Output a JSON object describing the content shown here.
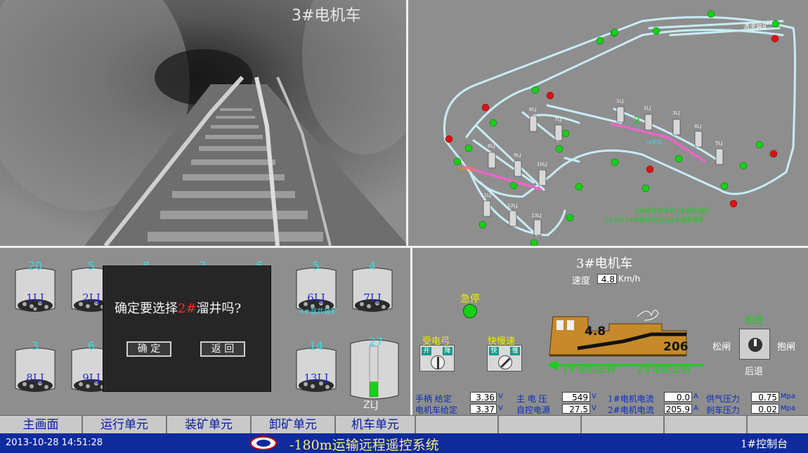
{
  "camera": {
    "title": "3#电机车"
  },
  "map": {
    "top_label": "清求装矿",
    "loco_labels": [
      "3#机车",
      "2#机车"
    ],
    "loco2_num": "2",
    "bins": [
      "1LJ",
      "2LJ",
      "3LJ",
      "4LJ",
      "5LJ",
      "6LJ",
      "7LJ",
      "8LJ",
      "9LJ",
      "10LJ",
      "11LJ",
      "12LJ",
      "13LJ"
    ],
    "log": [
      "2#操作台正在2#溜井装矿",
      "12:23:14本操作台正在8#溜井装矿"
    ]
  },
  "bins": {
    "row1": [
      {
        "name": "1LJ",
        "count": "20"
      },
      {
        "name": "2LJ",
        "count": "5"
      },
      {
        "name": "",
        "count": "8"
      },
      {
        "name": "",
        "count": "7"
      },
      {
        "name": "",
        "count": "6"
      },
      {
        "name": "6LJ",
        "count": "5"
      },
      {
        "name": "7LJ",
        "count": "4"
      }
    ],
    "row2": [
      {
        "name": "8LJ",
        "count": "3"
      },
      {
        "name": "9LJ",
        "count": "6"
      },
      {
        "name": "13LJ",
        "count": "14"
      }
    ],
    "main_bin": {
      "name": "ZLJ",
      "count": "27",
      "level": 0.3
    },
    "overlay_text": "4#溜井装矿"
  },
  "dialog": {
    "prefix": "确定要选择",
    "highlight": "2#",
    "suffix": "溜井吗?",
    "ok": "确 定",
    "back": "返 回"
  },
  "loco": {
    "title": "3#电机车",
    "speed_label": "速度",
    "speed_value": "4.8",
    "speed_unit": "Km/h",
    "estop_label": "急停",
    "power_label": "受电弓",
    "power_on": "开",
    "power_off": "降",
    "speed_switch_label": "快慢速",
    "fast": "快",
    "slow": "慢",
    "loco_value": "4.8",
    "loco_number": "206",
    "motor1": "1#电机正转",
    "motor2": "2#电机正转",
    "forward": "前进",
    "backward": "后退",
    "release": "松闸",
    "brake": "抱闸",
    "readouts": {
      "handle_label": "手柄  给定",
      "handle_value": "3.36",
      "loco_given_label": "电机车给定",
      "loco_given_value": "3.37",
      "main_v_label": "主 电 压",
      "main_v_value": "549",
      "auto_v_label": "自控电源",
      "auto_v_value": "27.5",
      "m1_i_label": "1#电机电流",
      "m1_i_value": "0.0",
      "m2_i_label": "2#电机电流",
      "m2_i_value": "205.9",
      "air_label": "供气压力",
      "air_value": "0.75",
      "brake_label": "刹车压力",
      "brake_value": "0.02",
      "unit_v": "V",
      "unit_a": "A",
      "unit_mpa": "Mpa"
    }
  },
  "nav": [
    "主画面",
    "运行单元",
    "装矿单元",
    "卸矿单元",
    "机车单元"
  ],
  "status": {
    "datetime": "2013-10-28 14:51:28",
    "title": "-180m运输远程遥控系统",
    "station": "1#控制台"
  },
  "colors": {
    "status_bar": "#0f2a9c",
    "track": "#c8ecf4",
    "pink": "#ff5fd0",
    "green_led": "#17d017",
    "red_led": "#e01010"
  }
}
